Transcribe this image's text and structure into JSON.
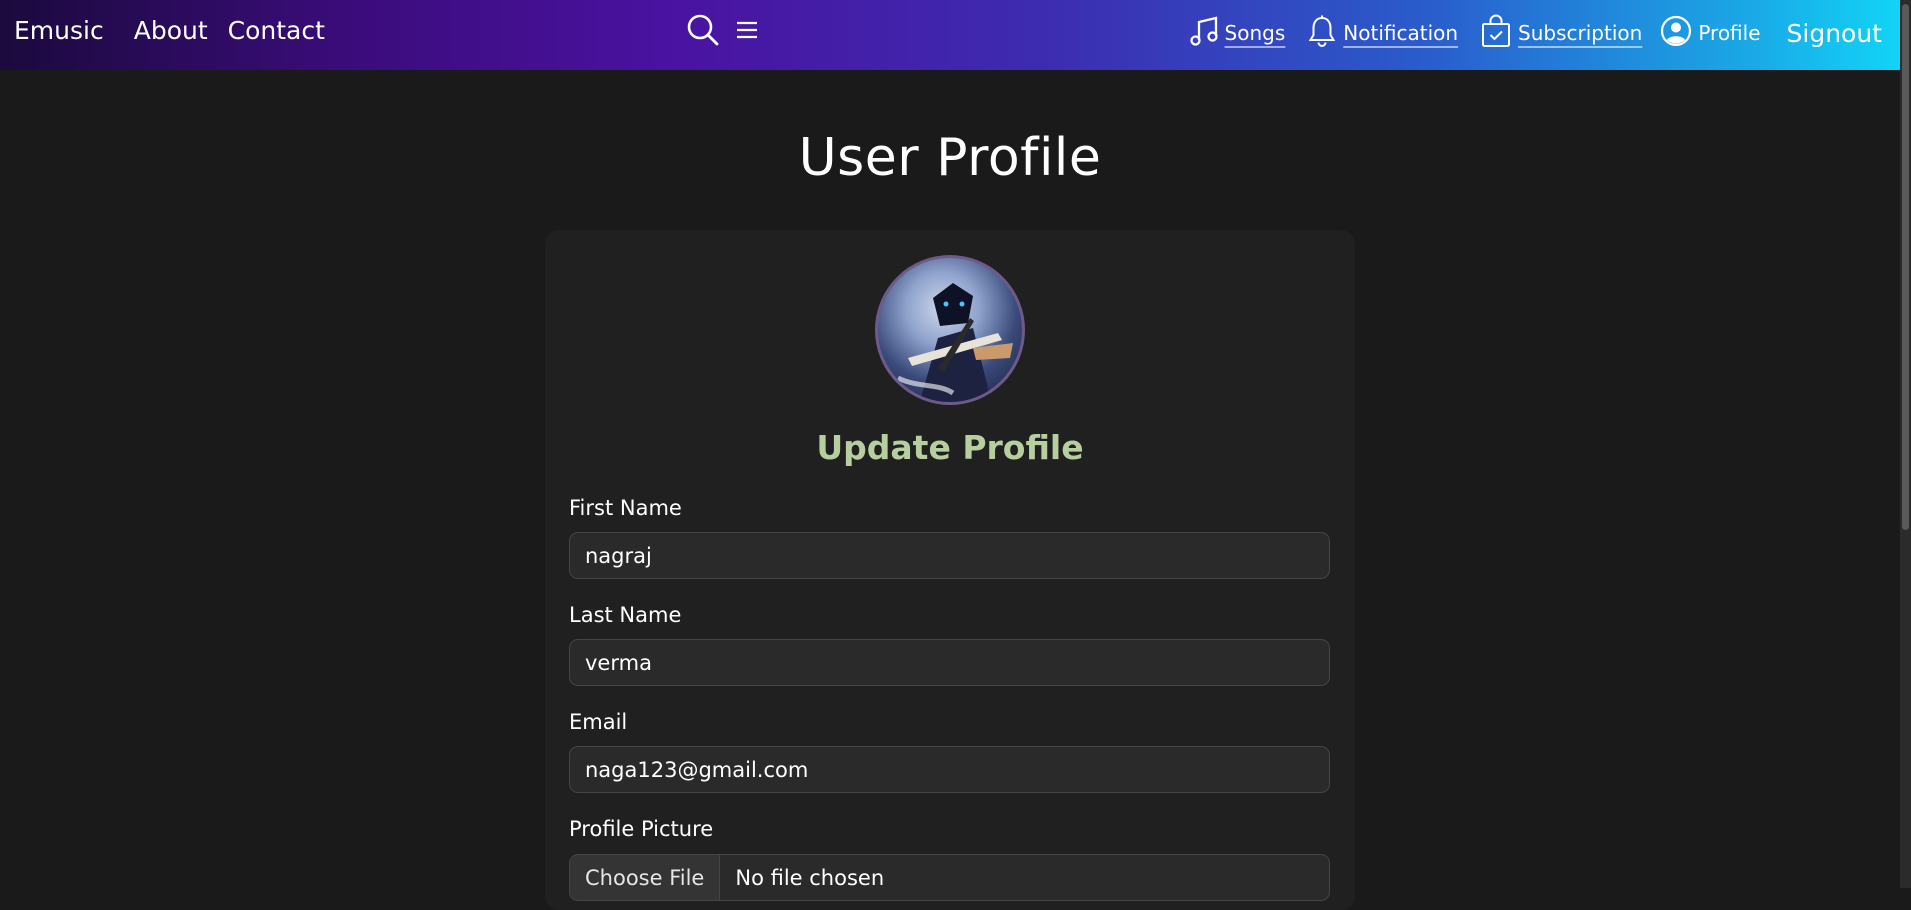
{
  "nav": {
    "brand": "Emusic",
    "links": [
      "About",
      "Contact"
    ],
    "icons": [
      "search-icon",
      "menu-icon"
    ],
    "right": {
      "songs": "Songs",
      "notification": "Notification",
      "subscription": "Subscription",
      "profile": "Profile",
      "signout": "Signout"
    }
  },
  "page": {
    "title": "User Profile"
  },
  "form": {
    "title": "Update Profile",
    "first_name": {
      "label": "First Name",
      "value": "nagraj"
    },
    "last_name": {
      "label": "Last Name",
      "value": "verma"
    },
    "email": {
      "label": "Email",
      "value": "naga123@gmail.com"
    },
    "profile_picture": {
      "label": "Profile Picture",
      "button": "Choose File",
      "status": "No file chosen"
    }
  },
  "colors": {
    "background": "#1a1a1a",
    "card": "#202020",
    "form_title": "#b7ce9e",
    "nav_gradient_start": "#1b0a3d",
    "nav_gradient_end": "#12d4f6"
  }
}
